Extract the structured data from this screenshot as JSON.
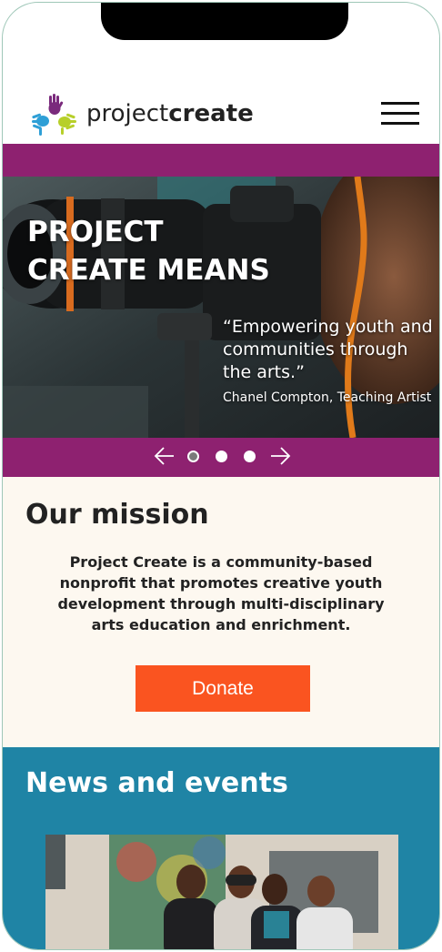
{
  "header": {
    "brand_light": "project",
    "brand_bold": "create",
    "menu_icon": "hamburger-menu-icon"
  },
  "hero": {
    "title": "PROJECT CREATE MEANS",
    "quote": "“Empowering youth and communities through the arts.”",
    "quote_author": "Chanel Compton, Teaching Artist"
  },
  "carousel": {
    "prev_icon": "arrow-left-icon",
    "next_icon": "arrow-right-icon",
    "slide_count": 3,
    "active_slide": 1
  },
  "mission": {
    "heading": "Our mission",
    "body": "Project Create is a community-based nonprofit that promotes creative youth development through multi-disciplinary arts education and enrichment.",
    "donate_label": "Donate"
  },
  "news": {
    "heading": "News and events"
  },
  "colors": {
    "purple": "#8e2170",
    "orange": "#fa5420",
    "teal": "#1f84a5",
    "cream": "#fdf8f0"
  }
}
